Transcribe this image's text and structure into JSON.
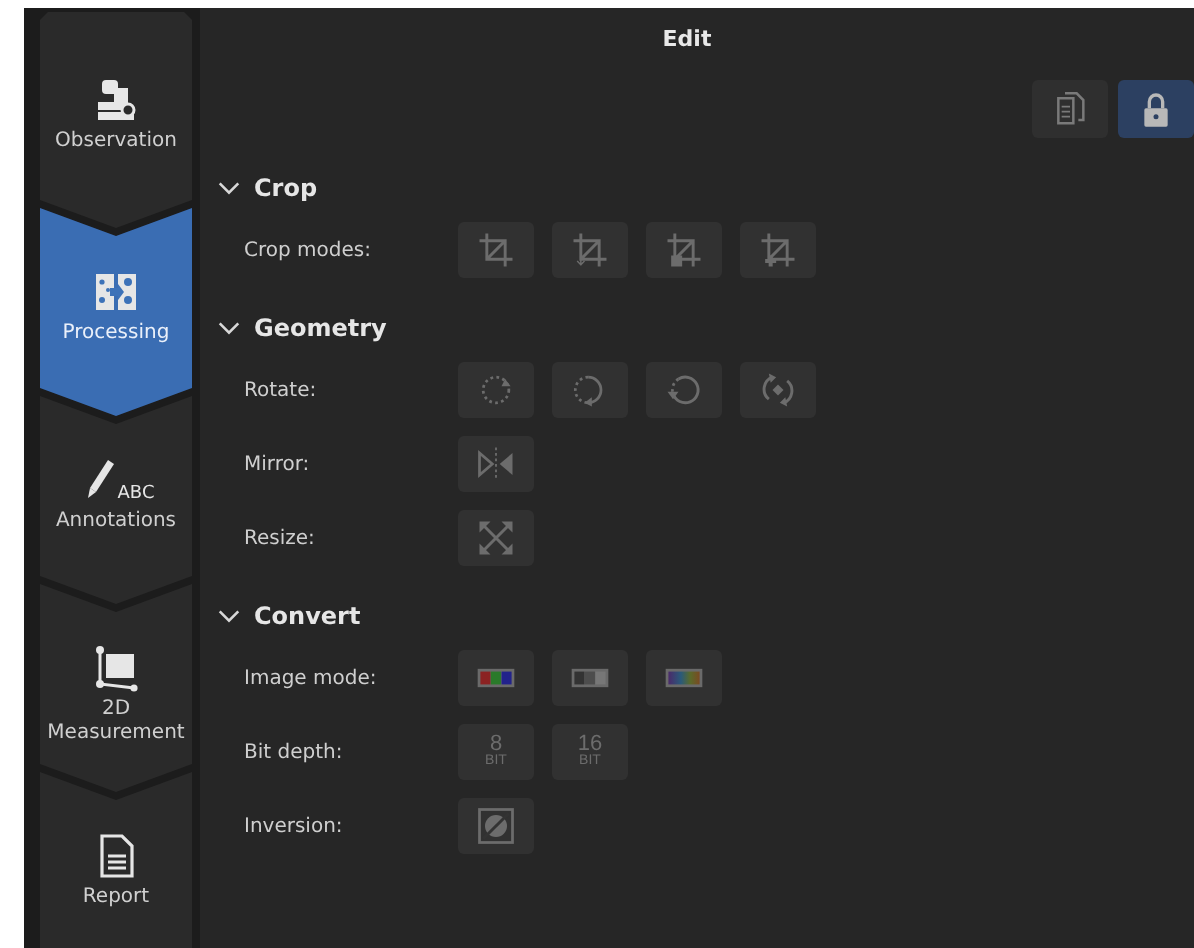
{
  "sidebar": {
    "tabs": [
      {
        "label": "Observation",
        "kind": "microscope",
        "selected": false
      },
      {
        "label": "Processing",
        "kind": "processing",
        "selected": true
      },
      {
        "label": "Annotations",
        "kind": "annotate",
        "icon_text": "ABC",
        "selected": false
      },
      {
        "label": "2D\nMeasurement",
        "kind": "measure",
        "selected": false
      },
      {
        "label": "Report",
        "kind": "report",
        "selected": false
      }
    ]
  },
  "panel": {
    "title": "Edit",
    "toolbar": [
      {
        "kind": "copy",
        "selected": false
      },
      {
        "kind": "lock",
        "selected": true
      }
    ],
    "sections": [
      {
        "title": "Crop",
        "expanded": true,
        "rows": [
          {
            "label": "Crop modes:",
            "buttons": [
              {
                "kind": "crop"
              },
              {
                "kind": "crop-auto"
              },
              {
                "kind": "crop-doc"
              },
              {
                "kind": "crop-add"
              }
            ]
          }
        ]
      },
      {
        "title": "Geometry",
        "expanded": true,
        "rows": [
          {
            "label": "Rotate:",
            "buttons": [
              {
                "kind": "rotate-cw"
              },
              {
                "kind": "rotate-ccw"
              },
              {
                "kind": "rotate-free"
              },
              {
                "kind": "rotate-auto"
              }
            ]
          },
          {
            "label": "Mirror:",
            "buttons": [
              {
                "kind": "mirror"
              }
            ]
          },
          {
            "label": "Resize:",
            "buttons": [
              {
                "kind": "resize"
              }
            ]
          }
        ]
      },
      {
        "title": "Convert",
        "expanded": true,
        "rows": [
          {
            "label": "Image mode:",
            "buttons": [
              {
                "kind": "rgb"
              },
              {
                "kind": "gray"
              },
              {
                "kind": "spectrum"
              }
            ]
          },
          {
            "label": "Bit depth:",
            "buttons": [
              {
                "kind": "bits",
                "number": "8",
                "unit": "BIT"
              },
              {
                "kind": "bits",
                "number": "16",
                "unit": "BIT"
              }
            ]
          },
          {
            "label": "Inversion:",
            "buttons": [
              {
                "kind": "invert"
              }
            ]
          }
        ]
      }
    ]
  }
}
